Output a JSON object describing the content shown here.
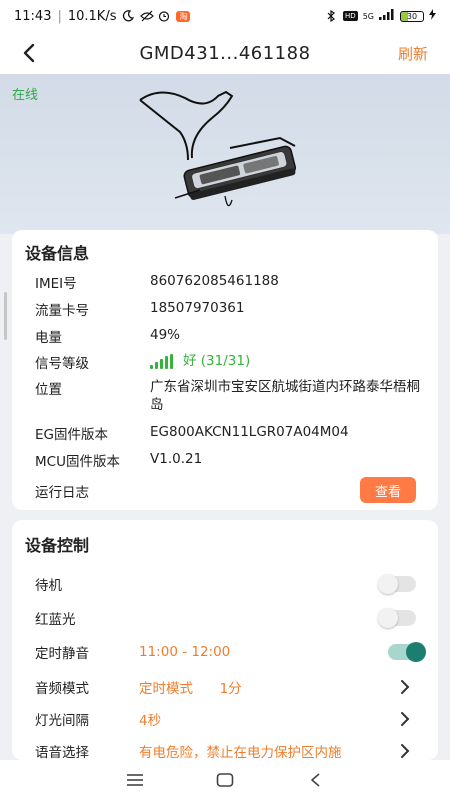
{
  "status_bar": {
    "time": "11:43",
    "net_speed": "10.1K/s",
    "signal_label": "5G",
    "battery_level": "30",
    "hd_label": "HD",
    "app_badge": "淘"
  },
  "header": {
    "title": "GMD431...461188",
    "refresh_label": "刷新"
  },
  "hero": {
    "online_status": "在线"
  },
  "device_info": {
    "title": "设备信息",
    "imei_label": "IMEI号",
    "imei_value": "860762085461188",
    "sim_label": "流量卡号",
    "sim_value": "18507970361",
    "battery_label": "电量",
    "battery_value": "49%",
    "signal_label": "信号等级",
    "signal_value": "好 (31/31)",
    "location_label": "位置",
    "location_value": "广东省深圳市宝安区航城街道内环路泰华梧桐岛",
    "eg_label": "EG固件版本",
    "eg_value": "EG800AKCN11LGR07A04M04",
    "mcu_label": "MCU固件版本",
    "mcu_value": "V1.0.21",
    "log_label": "运行日志",
    "view_label": "查看"
  },
  "device_control": {
    "title": "设备控制",
    "standby_label": "待机",
    "standby_on": false,
    "redblue_label": "红蓝光",
    "redblue_on": false,
    "mute_label": "定时静音",
    "mute_value": "11:00 - 12:00",
    "mute_on": true,
    "audio_mode_label": "音频模式",
    "audio_mode_value": "定时模式",
    "audio_mode_interval": "1分",
    "light_interval_label": "灯光间隔",
    "light_interval_value": "4秒",
    "voice_label": "语音选择",
    "voice_value": "有电危险，禁止在电力保护区内施"
  },
  "colors": {
    "accent_orange": "#f07d2e",
    "online_green": "#2fa84a",
    "signal_green": "#36b23d",
    "toggle_on": "#1b7e6e",
    "button_orange": "#ff7a45"
  },
  "icons": {
    "back": "chevron-left-icon",
    "chevron": "chevron-right-icon",
    "nav_menu": "menu-icon",
    "nav_home": "home-square-icon",
    "nav_back": "back-triangle-icon"
  }
}
